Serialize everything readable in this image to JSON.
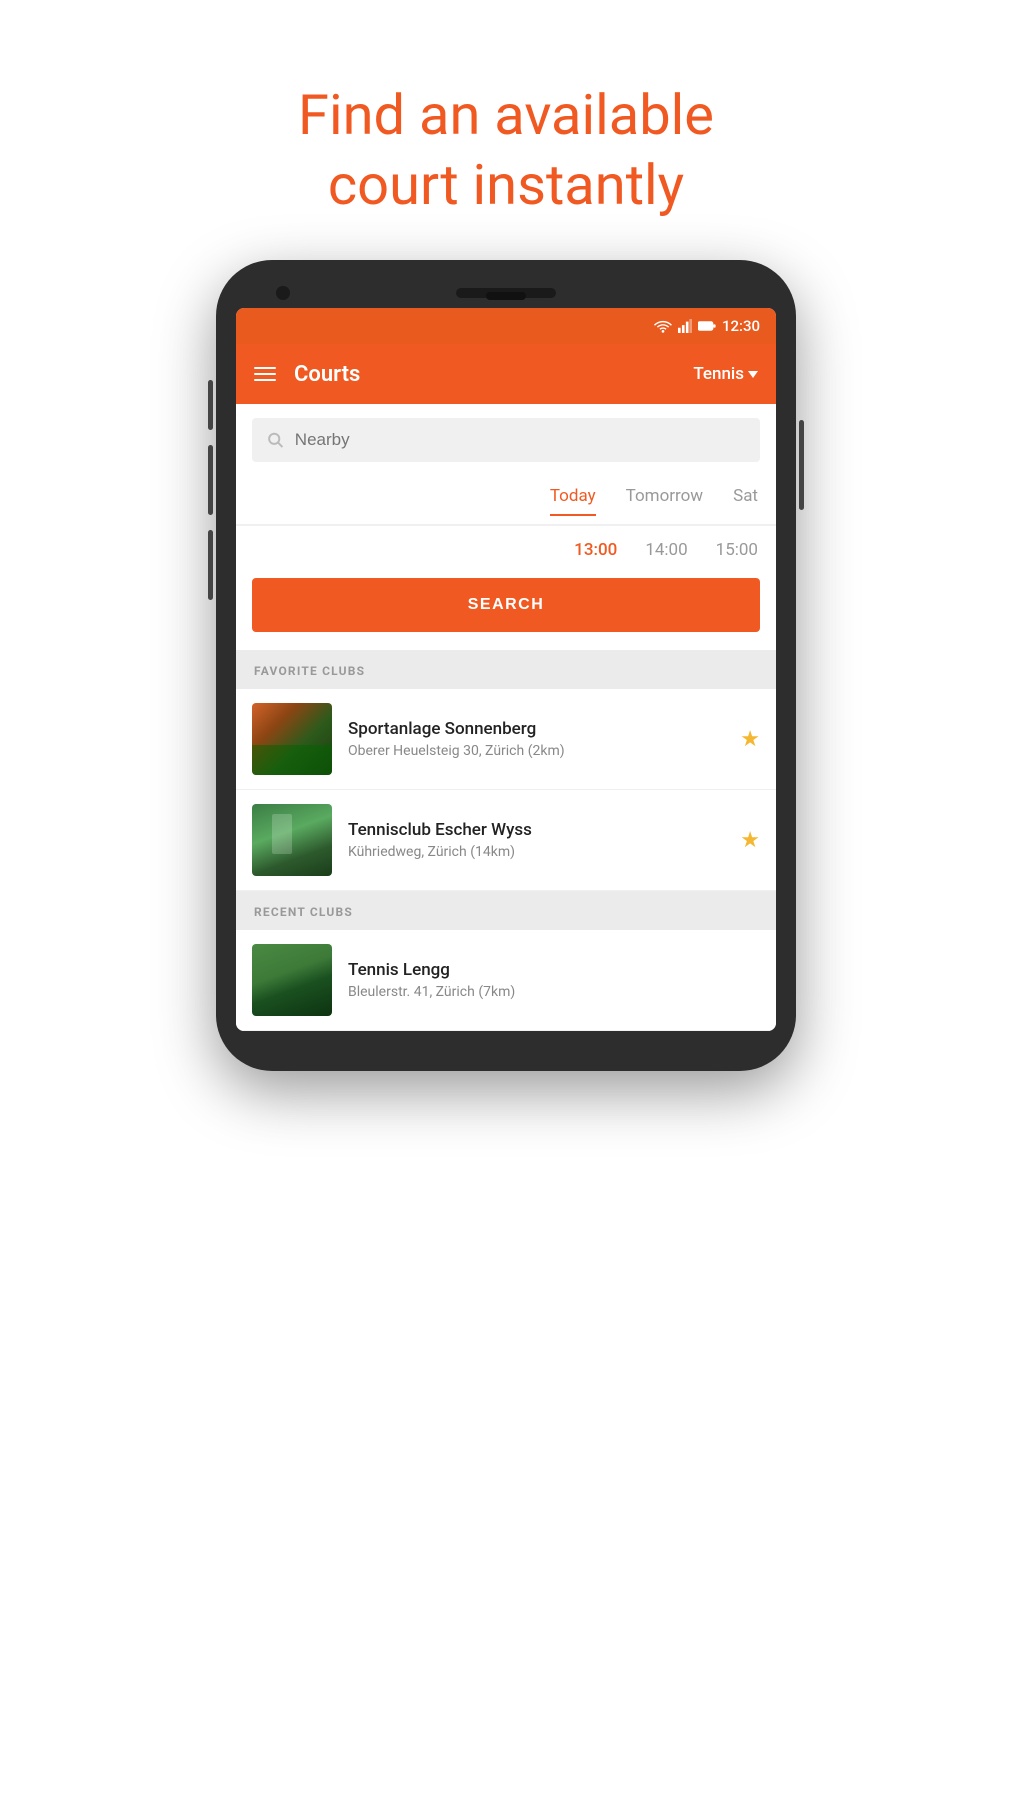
{
  "hero": {
    "title_line1": "Find an available",
    "title_line2": "court instantly"
  },
  "status_bar": {
    "time": "12:30"
  },
  "app_bar": {
    "title": "Courts",
    "sport_selector": "Tennis",
    "menu_icon": "hamburger"
  },
  "search": {
    "placeholder": "Nearby"
  },
  "days": [
    {
      "label": "Today",
      "active": true
    },
    {
      "label": "Tomorrow",
      "active": false
    },
    {
      "label": "Sat",
      "active": false
    }
  ],
  "times": [
    {
      "label": "13:00",
      "active": true
    },
    {
      "label": "14:00",
      "active": false
    },
    {
      "label": "15:00",
      "active": false
    }
  ],
  "search_button": {
    "label": "SEARCH"
  },
  "favorite_clubs": {
    "section_label": "FAVORITE CLUBS",
    "items": [
      {
        "name": "Sportanlage Sonnenberg",
        "address": "Oberer Heuelsteig 30, Zürich (2km)",
        "favorite": true,
        "thumb_class": "thumb-sonnenberg"
      },
      {
        "name": "Tennisclub Escher Wyss",
        "address": "Kühriedweg, Zürich (14km)",
        "favorite": true,
        "thumb_class": "thumb-escher"
      }
    ]
  },
  "recent_clubs": {
    "section_label": "RECENT CLUBS",
    "items": [
      {
        "name": "Tennis Lengg",
        "address": "Bleulerstr. 41, Zürich (7km)",
        "favorite": false,
        "thumb_class": "thumb-lengg"
      }
    ]
  }
}
